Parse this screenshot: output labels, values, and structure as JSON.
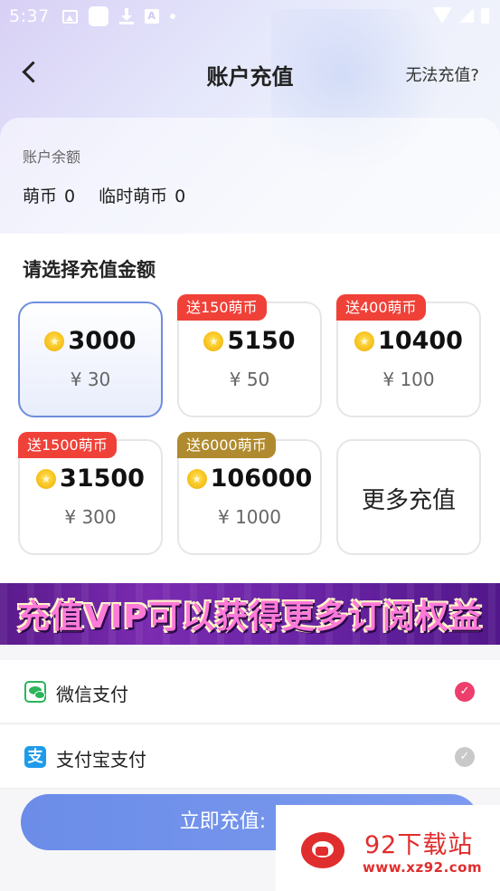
{
  "status_bar": {
    "time": "5:37"
  },
  "header": {
    "title": "账户充值",
    "help_link": "无法充值?"
  },
  "balance": {
    "label": "账户余额",
    "coins_label": "萌币",
    "coins_value": "0",
    "temp_coins_label": "临时萌币",
    "temp_coins_value": "0"
  },
  "select": {
    "title": "请选择充值金额",
    "packages": [
      {
        "coins": "3000",
        "price": "¥ 30",
        "bonus": "",
        "selected": true
      },
      {
        "coins": "5150",
        "price": "¥ 50",
        "bonus": "送150萌币"
      },
      {
        "coins": "10400",
        "price": "¥ 100",
        "bonus": "送400萌币"
      },
      {
        "coins": "31500",
        "price": "¥ 300",
        "bonus": "送1500萌币"
      },
      {
        "coins": "106000",
        "price": "¥ 1000",
        "bonus": "送6000萌币"
      }
    ],
    "more_label": "更多充值"
  },
  "banner": {
    "text": "充值VIP可以获得更多订阅权益"
  },
  "payments": [
    {
      "label": "微信支付",
      "icon": "wechat-icon",
      "selected": true
    },
    {
      "label": "支付宝支付",
      "icon": "alipay-icon",
      "icon_glyph": "支",
      "selected": false
    }
  ],
  "submit": {
    "label": "立即充值:"
  },
  "watermark": {
    "title": "92下载站",
    "url": "www.xz92.com"
  },
  "colors": {
    "accent": "#6f8ddc",
    "bonus_red": "#ef4138",
    "bonus_gold": "#b08a2e",
    "check_on": "#ee3e6c",
    "button": "#7391ea"
  }
}
